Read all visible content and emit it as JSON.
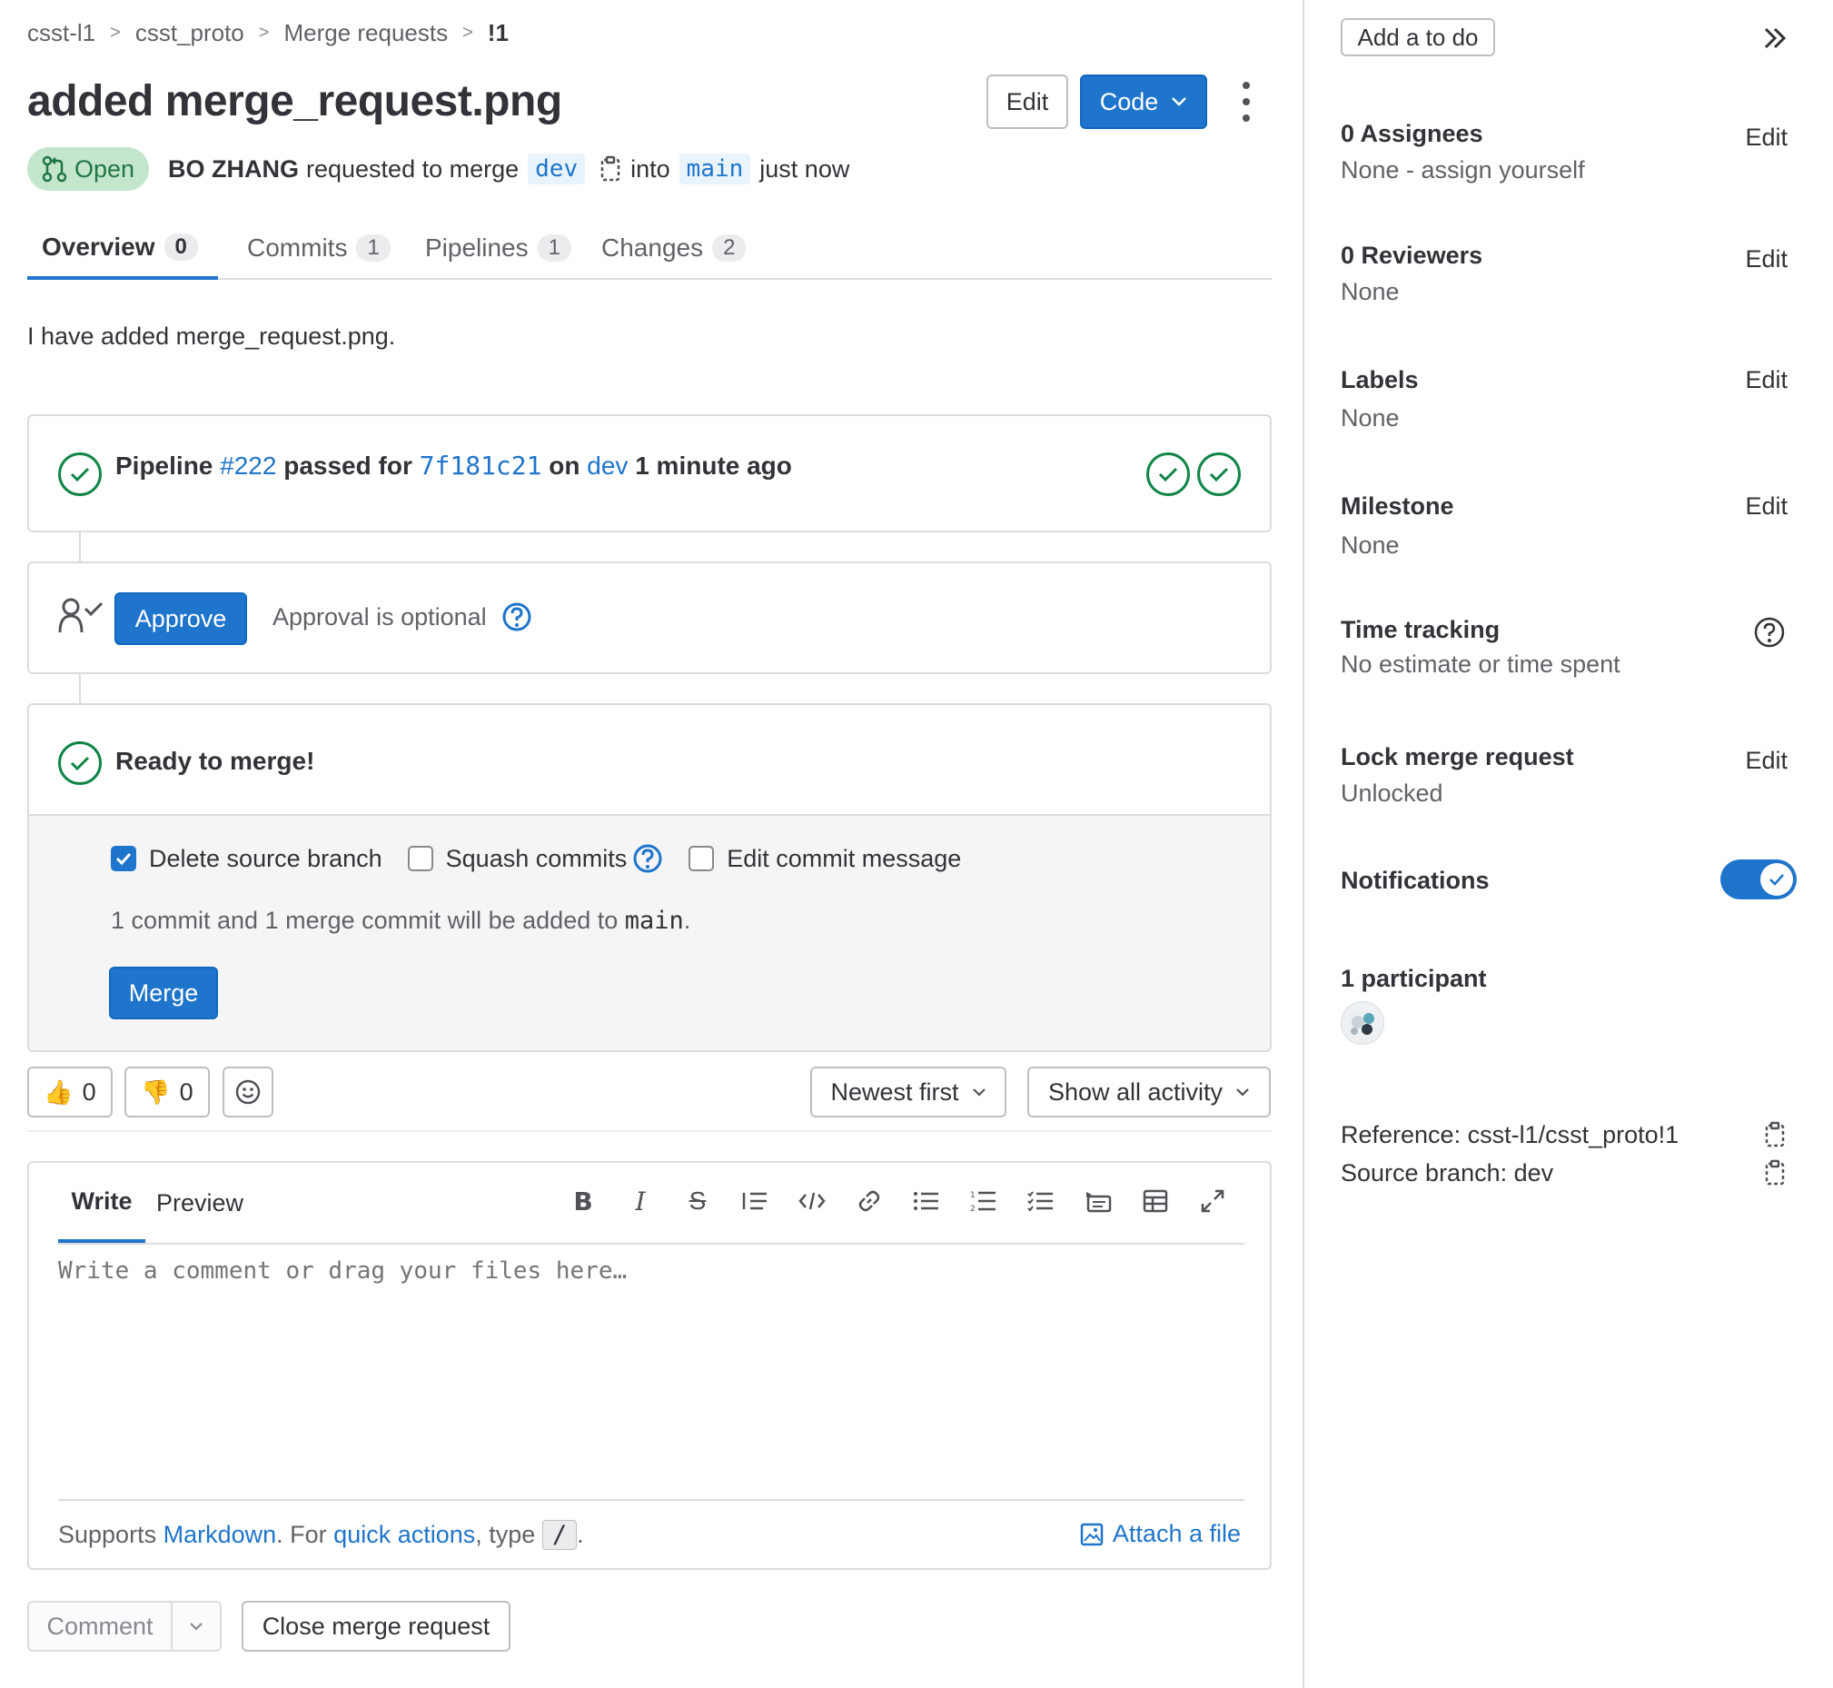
{
  "breadcrumb": [
    "csst-l1",
    "csst_proto",
    "Merge requests",
    "!1"
  ],
  "title": "added merge_request.png",
  "header_buttons": {
    "edit": "Edit",
    "code": "Code"
  },
  "status": "Open",
  "meta": {
    "author": "BO ZHANG",
    "requested": "requested to merge",
    "source": "dev",
    "into": "into",
    "target": "main",
    "time": "just now"
  },
  "tabs": [
    {
      "label": "Overview",
      "count": "0"
    },
    {
      "label": "Commits",
      "count": "1"
    },
    {
      "label": "Pipelines",
      "count": "1"
    },
    {
      "label": "Changes",
      "count": "2"
    }
  ],
  "description": "I have added merge_request.png.",
  "pipeline": {
    "word": "Pipeline",
    "id": "#222",
    "passed_for": "passed for",
    "commit": "7f181c21",
    "on": "on",
    "branch": "dev",
    "ago": "1 minute ago"
  },
  "approval": {
    "button": "Approve",
    "text": "Approval is optional"
  },
  "merge": {
    "ready": "Ready to merge!",
    "delete_branch": "Delete source branch",
    "squash": "Squash commits",
    "edit_msg": "Edit commit message",
    "summary_prefix": "1 commit and 1 merge commit will be added to",
    "summary_branch": "main",
    "summary_suffix": ".",
    "button": "Merge"
  },
  "reactions": {
    "thumbs_up": "0",
    "thumbs_down": "0"
  },
  "sort": {
    "order": "Newest first",
    "filter": "Show all activity"
  },
  "editor": {
    "write": "Write",
    "preview": "Preview",
    "placeholder": "Write a comment or drag your files here…",
    "supports": "Supports",
    "markdown": "Markdown",
    "for": ". For",
    "quick_actions": "quick actions",
    "type": ", type",
    "slash": "/",
    "end": ".",
    "attach": "Attach a file"
  },
  "footer_buttons": {
    "comment": "Comment",
    "close": "Close merge request"
  },
  "sidebar": {
    "todo": "Add a to do",
    "assignees_title": "0 Assignees",
    "assignees_value": "None - assign yourself",
    "reviewers_title": "0 Reviewers",
    "reviewers_value": "None",
    "labels_title": "Labels",
    "labels_value": "None",
    "milestone_title": "Milestone",
    "milestone_value": "None",
    "time_title": "Time tracking",
    "time_value": "No estimate or time spent",
    "lock_title": "Lock merge request",
    "lock_value": "Unlocked",
    "notifications_title": "Notifications",
    "notifications_on": true,
    "participants_title": "1 participant",
    "reference": "Reference: csst-l1/csst_proto!1",
    "source_branch": "Source branch: dev",
    "edit": "Edit"
  },
  "colors": {
    "accent": "#1f75cb",
    "success": "#108548",
    "badge_bg": "#c3e6cd"
  }
}
